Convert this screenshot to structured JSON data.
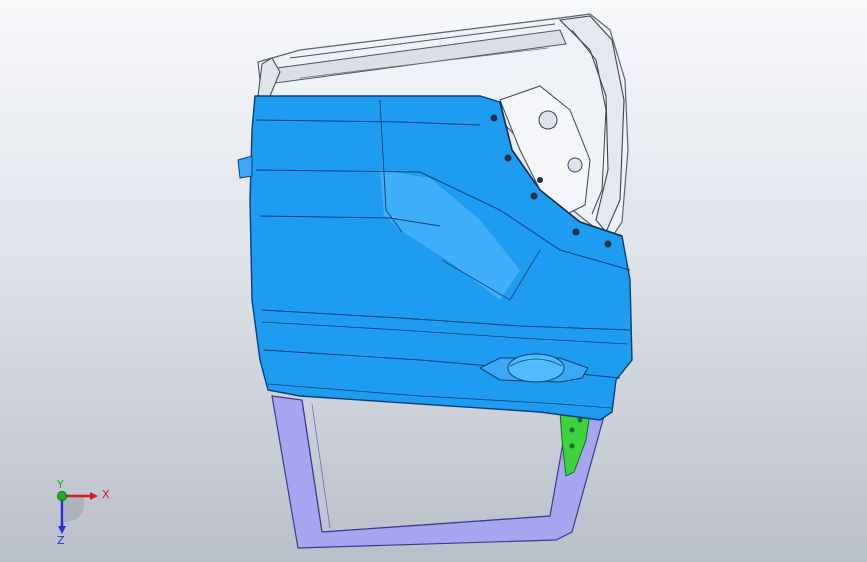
{
  "triad": {
    "x_label": "X",
    "y_label": "Y",
    "z_label": "Z"
  },
  "colors": {
    "door_skin": "#1e9cf0",
    "door_skin_light": "#4fb8ff",
    "door_edge": "#0a3f7a",
    "frame": "#a6a6f0",
    "inner_panel": "#eef1f6",
    "bracket": "#3fd43f",
    "x_axis": "#d81b1b",
    "y_axis": "#1bb31b",
    "z_axis": "#2b2bd6"
  }
}
